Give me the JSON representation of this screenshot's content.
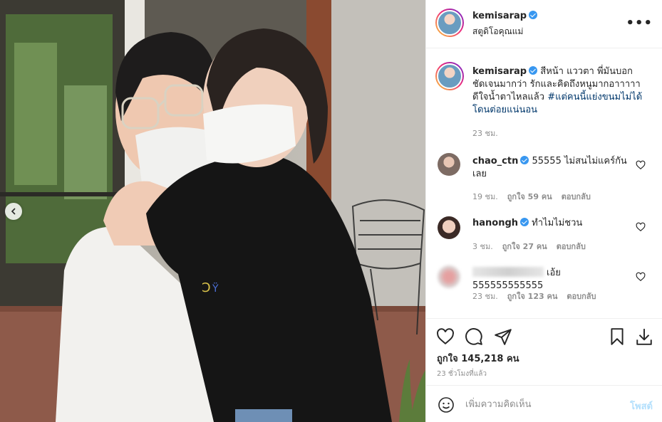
{
  "post": {
    "username": "kemisarap",
    "location": "สตูดิโอคุณแม่",
    "more_label": "•••",
    "caption_text": "สีหน้า แววตา พี่มันบอกชัดเจนมากว่า รักและคิดถึงหนูมากอาาาาาดีใจน้ำตาไหลแล้ว ",
    "caption_hashtag": "#แต่คนนี้แย่งขนมไม่ได้โดนต่อยแน่นอน",
    "caption_time": "23 ชม."
  },
  "comments": [
    {
      "username": "chao_ctn",
      "verified": true,
      "text": "55555 ไม่สนไม่แคร์กันเลย",
      "time": "19 ชม.",
      "likes": "ถูกใจ 59 คน",
      "reply": "ตอบกลับ"
    },
    {
      "username": "hanongh",
      "verified": true,
      "text": "ทำไมไม่ชวน",
      "time": "3 ชม.",
      "likes": "ถูกใจ 27 คน",
      "reply": "ตอบกลับ"
    },
    {
      "username": "",
      "verified": false,
      "text": "เอ้ย 555555555555",
      "time": "23 ชม.",
      "likes": "ถูกใจ 123 คน",
      "reply": "ตอบกลับ"
    }
  ],
  "engagement": {
    "likes_text": "ถูกใจ 145,218 คน",
    "posted_ago": "23 ชั่วโมงที่แล้ว"
  },
  "composer": {
    "placeholder": "เพิ่มความคิดเห็น",
    "post_label": "โพสต์"
  },
  "icons": {
    "like": "heart-icon",
    "comment": "comment-icon",
    "share": "send-icon",
    "save": "bookmark-icon",
    "download": "download-icon",
    "emoji": "emoji-icon",
    "prev": "chevron-left-icon"
  },
  "colors": {
    "verified": "#3897f0",
    "hashtag": "#00376b",
    "post_button": "#b2dffc",
    "muted": "#8e8e8e"
  }
}
